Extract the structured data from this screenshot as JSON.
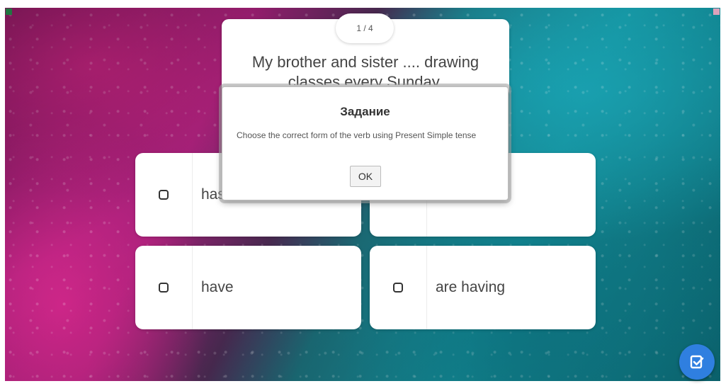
{
  "quiz": {
    "counter": "1 / 4",
    "question": "My brother and sister .... drawing classes every Sunday.",
    "answers": [
      {
        "label": "has"
      },
      {
        "label": ""
      },
      {
        "label": "have"
      },
      {
        "label": "are having"
      }
    ]
  },
  "dialog": {
    "title": "Задание",
    "text": "Choose the correct form of the verb using Present Simple tense",
    "ok_label": "OK"
  },
  "icons": {
    "check_button": "checklist-icon",
    "checkbox": "checkbox-icon"
  },
  "colors": {
    "accent": "#2f7fe0",
    "magenta": "#c2237f",
    "teal": "#1aa6b6"
  }
}
